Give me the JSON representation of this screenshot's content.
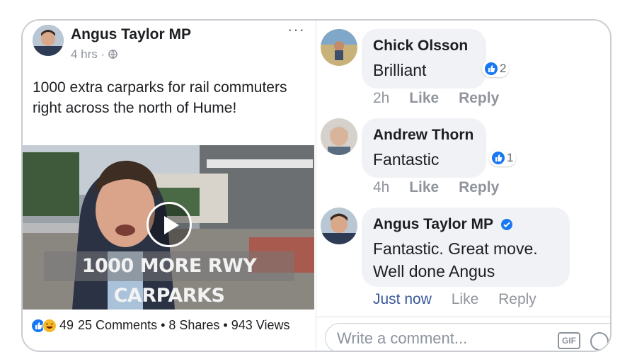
{
  "post": {
    "author": "Angus Taylor MP",
    "time": "4 hrs",
    "visibility_sep": "·",
    "menu": "···",
    "text": "1000 extra carparks for rail commuters right across the north of Hume!",
    "video_caption": "1000 MORE RWY CARPARKS",
    "reactions_count": "49",
    "stats": "25 Comments • 8 Shares • 943 Views"
  },
  "comments": [
    {
      "author": "Chick Olsson",
      "text": "Brilliant",
      "likes": "2",
      "time": "2h",
      "like_label": "Like",
      "reply_label": "Reply"
    },
    {
      "author": "Andrew Thorn",
      "text": "Fantastic",
      "likes": "1",
      "time": "4h",
      "like_label": "Like",
      "reply_label": "Reply"
    },
    {
      "author": "Angus Taylor MP",
      "text_line1": "Fantastic. Great move.",
      "text_line2": "Well done Angus",
      "time": "Just now",
      "like_label": "Like",
      "reply_label": "Reply"
    }
  ],
  "composer": {
    "placeholder": "Write a comment...",
    "gif_label": "GIF"
  },
  "icons": [
    "globe-icon",
    "play-icon",
    "like-reaction-icon",
    "haha-reaction-icon",
    "verified-badge-icon",
    "gif-icon",
    "emoji-icon"
  ],
  "colors": {
    "accent": "#1877f2",
    "link": "#385898",
    "bubble": "#f0f2f5"
  }
}
